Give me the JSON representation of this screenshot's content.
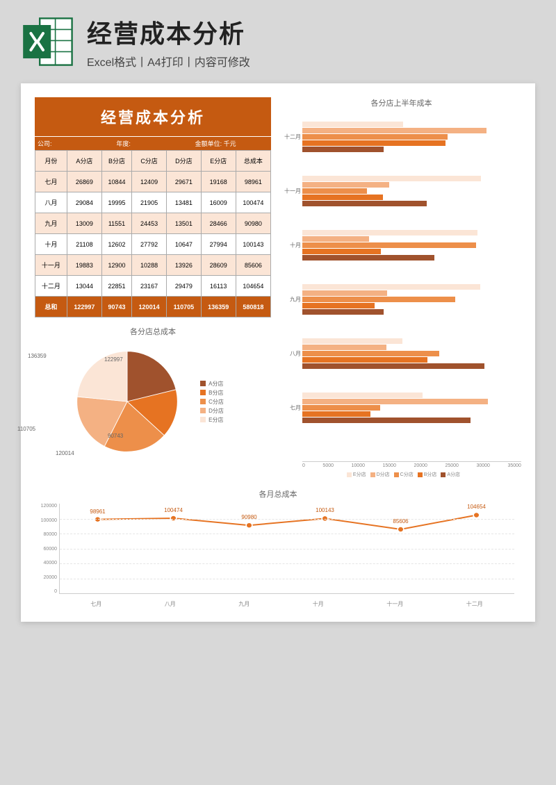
{
  "header": {
    "title": "经营成本分析",
    "subtitle": "Excel格式丨A4打印丨内容可修改",
    "icon_name": "excel-icon"
  },
  "banner": "经营成本分析",
  "meta": {
    "company_label": "公司:",
    "year_label": "年度:",
    "unit_label": "金额单位: 千元"
  },
  "table": {
    "headers": [
      "月份",
      "A分店",
      "B分店",
      "C分店",
      "D分店",
      "E分店",
      "总成本"
    ],
    "rows": [
      {
        "m": "七月",
        "v": [
          26869,
          10844,
          12409,
          29671,
          19168,
          98961
        ]
      },
      {
        "m": "八月",
        "v": [
          29084,
          19995,
          21905,
          13481,
          16009,
          100474
        ]
      },
      {
        "m": "九月",
        "v": [
          13009,
          11551,
          24453,
          13501,
          28466,
          90980
        ]
      },
      {
        "m": "十月",
        "v": [
          21108,
          12602,
          27792,
          10647,
          27994,
          100143
        ]
      },
      {
        "m": "十一月",
        "v": [
          19883,
          12900,
          10288,
          13926,
          28609,
          85606
        ]
      },
      {
        "m": "十二月",
        "v": [
          13044,
          22851,
          23167,
          29479,
          16113,
          104654
        ]
      }
    ],
    "total": {
      "label": "总和",
      "v": [
        122997,
        90743,
        120014,
        110705,
        136359,
        580818
      ]
    }
  },
  "pie": {
    "title": "各分店总成本",
    "legend": [
      "A分店",
      "B分店",
      "C分店",
      "D分店",
      "E分店"
    ],
    "colors": [
      "#a0522d",
      "#e67322",
      "#ed8f4a",
      "#f4b183",
      "#fbe5d6"
    ]
  },
  "hbar": {
    "title": "各分店上半年成本",
    "months": [
      "十二月",
      "十一月",
      "十月",
      "九月",
      "八月",
      "七月"
    ],
    "legend": [
      "E分店",
      "D分店",
      "C分店",
      "B分店",
      "A分店"
    ],
    "colors": [
      "#fbe5d6",
      "#f4b183",
      "#ed8f4a",
      "#e67322",
      "#a0522d"
    ],
    "xmax": 35000,
    "ticks": [
      "0",
      "5000",
      "10000",
      "15000",
      "20000",
      "25000",
      "30000",
      "35000"
    ]
  },
  "line": {
    "title": "各月总成本",
    "ylim": [
      0,
      120000
    ],
    "yticks": [
      "120000",
      "100000",
      "80000",
      "60000",
      "40000",
      "20000",
      "0"
    ],
    "color": "#e67322"
  },
  "chart_data": [
    {
      "type": "pie",
      "title": "各分店总成本",
      "categories": [
        "A分店",
        "B分店",
        "C分店",
        "D分店",
        "E分店"
      ],
      "values": [
        122997,
        90743,
        120014,
        110705,
        136359
      ]
    },
    {
      "type": "bar",
      "orientation": "horizontal",
      "title": "各分店上半年成本",
      "categories": [
        "七月",
        "八月",
        "九月",
        "十月",
        "十一月",
        "十二月"
      ],
      "series": [
        {
          "name": "A分店",
          "values": [
            26869,
            29084,
            13009,
            21108,
            19883,
            13044
          ]
        },
        {
          "name": "B分店",
          "values": [
            10844,
            19995,
            11551,
            12602,
            12900,
            22851
          ]
        },
        {
          "name": "C分店",
          "values": [
            12409,
            21905,
            24453,
            27792,
            10288,
            23167
          ]
        },
        {
          "name": "D分店",
          "values": [
            29671,
            13481,
            13501,
            10647,
            13926,
            29479
          ]
        },
        {
          "name": "E分店",
          "values": [
            19168,
            16009,
            28466,
            27994,
            28609,
            16113
          ]
        }
      ],
      "xlabel": "",
      "ylabel": "",
      "xlim": [
        0,
        35000
      ]
    },
    {
      "type": "line",
      "title": "各月总成本",
      "categories": [
        "七月",
        "八月",
        "九月",
        "十月",
        "十一月",
        "十二月"
      ],
      "values": [
        98961,
        100474,
        90980,
        100143,
        85606,
        104654
      ],
      "ylim": [
        0,
        120000
      ]
    }
  ]
}
